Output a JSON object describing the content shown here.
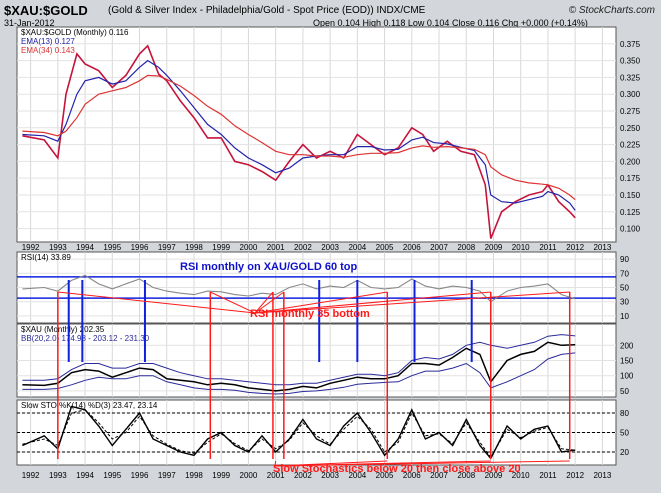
{
  "header": {
    "title": "$XAU:$GOLD",
    "subtitle": "(Gold & Silver Index - Philadelphia/Gold - Spot Price (EOD))  INDX/CME",
    "date": "31-Jan-2012",
    "ohlc": "Open 0.104  High 0.118  Low 0.104  Close 0.116  Chg +0.000 (+0.14%)",
    "brand": "© StockCharts.com"
  },
  "colors": {
    "price": "#c4143c",
    "ema13": "#2222aa",
    "ema34": "#dd3333",
    "annotation_red": "#ff1a1a",
    "annotation_blue": "#1020e0",
    "annotation_text": "#1010cc"
  },
  "chart_data": [
    {
      "type": "line",
      "panel": "price",
      "legend": [
        "$XAU:$GOLD (Monthly) 0.116",
        "EMA(13) 0.127",
        "EMA(34) 0.143"
      ],
      "yticks": [
        "0.375",
        "0.350",
        "0.325",
        "0.300",
        "0.275",
        "0.250",
        "0.225",
        "0.200",
        "0.175",
        "0.150",
        "0.125",
        "0.100"
      ],
      "ylim": [
        0.08,
        0.4
      ],
      "x": [
        1991.7,
        1992.5,
        1993.0,
        1993.3,
        1993.7,
        1994.0,
        1994.5,
        1995.0,
        1995.5,
        1996.0,
        1996.3,
        1996.7,
        1997.0,
        1997.5,
        1998.0,
        1998.5,
        1999.0,
        1999.5,
        2000.0,
        2000.5,
        2001.0,
        2001.5,
        2002.0,
        2002.5,
        2003.0,
        2003.5,
        2004.0,
        2004.5,
        2005.0,
        2005.5,
        2006.0,
        2006.4,
        2006.8,
        2007.3,
        2007.8,
        2008.3,
        2008.7,
        2008.9,
        2009.3,
        2009.8,
        2010.3,
        2010.8,
        2011.0,
        2011.4,
        2011.8,
        2012.0
      ],
      "series": [
        {
          "name": "$XAU:$GOLD (Monthly) 0.116",
          "values": [
            0.238,
            0.232,
            0.205,
            0.3,
            0.36,
            0.345,
            0.335,
            0.31,
            0.328,
            0.36,
            0.372,
            0.33,
            0.32,
            0.29,
            0.265,
            0.235,
            0.235,
            0.2,
            0.195,
            0.185,
            0.172,
            0.2,
            0.225,
            0.205,
            0.215,
            0.205,
            0.24,
            0.225,
            0.21,
            0.22,
            0.25,
            0.24,
            0.215,
            0.23,
            0.215,
            0.21,
            0.165,
            0.085,
            0.125,
            0.14,
            0.15,
            0.155,
            0.165,
            0.14,
            0.125,
            0.116
          ]
        },
        {
          "name": "EMA(13) 0.127",
          "values": [
            0.24,
            0.238,
            0.23,
            0.255,
            0.3,
            0.32,
            0.325,
            0.315,
            0.32,
            0.34,
            0.35,
            0.34,
            0.328,
            0.305,
            0.28,
            0.255,
            0.24,
            0.22,
            0.205,
            0.195,
            0.183,
            0.19,
            0.205,
            0.208,
            0.21,
            0.21,
            0.222,
            0.222,
            0.217,
            0.218,
            0.232,
            0.236,
            0.228,
            0.226,
            0.221,
            0.216,
            0.195,
            0.15,
            0.14,
            0.138,
            0.143,
            0.148,
            0.155,
            0.15,
            0.138,
            0.127
          ]
        },
        {
          "name": "EMA(34) 0.143",
          "values": [
            0.245,
            0.243,
            0.238,
            0.245,
            0.265,
            0.285,
            0.3,
            0.305,
            0.31,
            0.32,
            0.328,
            0.327,
            0.322,
            0.312,
            0.298,
            0.282,
            0.27,
            0.253,
            0.24,
            0.228,
            0.215,
            0.21,
            0.21,
            0.208,
            0.208,
            0.206,
            0.21,
            0.212,
            0.212,
            0.213,
            0.22,
            0.223,
            0.221,
            0.222,
            0.22,
            0.218,
            0.21,
            0.192,
            0.18,
            0.172,
            0.168,
            0.166,
            0.165,
            0.16,
            0.15,
            0.143
          ]
        }
      ],
      "xticks": [
        "1992",
        "1993",
        "1994",
        "1995",
        "1996",
        "1997",
        "1998",
        "1999",
        "2000",
        "2001",
        "2002",
        "2003",
        "2004",
        "2005",
        "2006",
        "2007",
        "2008",
        "2009",
        "2010",
        "2011",
        "2012",
        "2013"
      ]
    },
    {
      "type": "line",
      "panel": "rsi",
      "legend": [
        "RSI(14) 33.89"
      ],
      "annotations": [
        "RSI monthly on XAU/GOLD 60 top",
        "RSI monthly 35 bottom"
      ],
      "yticks": [
        "90",
        "70",
        "50",
        "30",
        "10"
      ],
      "ylim": [
        0,
        100
      ],
      "hlines": [
        65,
        35
      ],
      "x": [
        1991.7,
        1992.5,
        1993.0,
        1993.5,
        1994.0,
        1994.5,
        1995.0,
        1995.5,
        1996.0,
        1996.5,
        1997.0,
        1997.5,
        1998.0,
        1998.5,
        1999.0,
        1999.5,
        2000.0,
        2000.5,
        2001.0,
        2001.5,
        2002.0,
        2002.5,
        2003.0,
        2003.5,
        2004.0,
        2004.5,
        2005.0,
        2005.5,
        2006.0,
        2006.5,
        2007.0,
        2007.5,
        2008.0,
        2008.5,
        2008.9,
        2009.5,
        2010.0,
        2010.5,
        2011.0,
        2011.5,
        2012.0
      ],
      "series": [
        {
          "name": "RSI(14) 33.89",
          "values": [
            48,
            50,
            45,
            60,
            67,
            55,
            48,
            55,
            62,
            50,
            45,
            42,
            40,
            45,
            44,
            40,
            38,
            42,
            40,
            50,
            55,
            48,
            52,
            50,
            60,
            50,
            48,
            50,
            62,
            52,
            48,
            52,
            50,
            45,
            30,
            45,
            50,
            52,
            55,
            40,
            34
          ]
        }
      ]
    },
    {
      "type": "line",
      "panel": "xau",
      "legend": [
        "$XAU (Monthly) 202.35",
        "BB(20,2.0) 174.98 - 203.12 - 231.30"
      ],
      "yticks": [
        "200",
        "150",
        "100",
        "50"
      ],
      "ylim": [
        30,
        270
      ],
      "x": [
        1991.7,
        1992.5,
        1993.0,
        1993.5,
        1994.0,
        1994.5,
        1995.0,
        1995.5,
        1996.0,
        1996.5,
        1997.0,
        1997.5,
        1998.0,
        1998.5,
        1999.0,
        1999.5,
        2000.0,
        2000.5,
        2001.0,
        2001.5,
        2002.0,
        2002.5,
        2003.0,
        2003.5,
        2004.0,
        2004.5,
        2005.0,
        2005.5,
        2006.0,
        2006.5,
        2007.0,
        2007.5,
        2008.0,
        2008.5,
        2008.9,
        2009.5,
        2010.0,
        2010.5,
        2011.0,
        2011.5,
        2012.0
      ],
      "series": [
        {
          "name": "$XAU (Monthly) 202.35",
          "values": [
            70,
            68,
            75,
            110,
            120,
            115,
            95,
            110,
            125,
            120,
            90,
            85,
            80,
            70,
            75,
            70,
            60,
            55,
            50,
            55,
            65,
            60,
            75,
            85,
            95,
            90,
            90,
            100,
            140,
            140,
            135,
            160,
            190,
            170,
            80,
            150,
            170,
            180,
            210,
            200,
            202
          ]
        },
        {
          "name": "BB upper",
          "values": [
            85,
            85,
            90,
            120,
            140,
            140,
            125,
            125,
            140,
            140,
            125,
            110,
            100,
            90,
            90,
            85,
            80,
            75,
            70,
            70,
            75,
            75,
            85,
            95,
            105,
            105,
            100,
            110,
            150,
            160,
            155,
            170,
            200,
            210,
            200,
            190,
            200,
            210,
            230,
            235,
            231
          ]
        },
        {
          "name": "BB lower",
          "values": [
            55,
            55,
            58,
            70,
            85,
            95,
            90,
            90,
            100,
            100,
            80,
            70,
            60,
            55,
            55,
            52,
            45,
            42,
            40,
            42,
            48,
            50,
            55,
            62,
            72,
            75,
            78,
            80,
            100,
            115,
            115,
            125,
            140,
            110,
            60,
            80,
            100,
            120,
            155,
            170,
            175
          ]
        }
      ]
    },
    {
      "type": "line",
      "panel": "stochastic",
      "legend": [
        "Slow STO %K(14) %D(3) 23.47, 23.14"
      ],
      "annotations": [
        "Slow Stochastics below 20 then close above 20"
      ],
      "yticks": [
        "80",
        "50",
        "20"
      ],
      "ylim": [
        0,
        100
      ],
      "hlines": [
        80,
        50,
        20
      ],
      "x": [
        1991.7,
        1992.5,
        1993.0,
        1993.5,
        1994.0,
        1994.5,
        1995.0,
        1995.5,
        1996.0,
        1996.5,
        1997.0,
        1997.5,
        1998.0,
        1998.5,
        1999.0,
        1999.5,
        2000.0,
        2000.5,
        2001.0,
        2001.5,
        2002.0,
        2002.5,
        2003.0,
        2003.5,
        2004.0,
        2004.5,
        2005.0,
        2005.5,
        2006.0,
        2006.5,
        2007.0,
        2007.5,
        2008.0,
        2008.5,
        2008.9,
        2009.5,
        2010.0,
        2010.5,
        2011.0,
        2011.5,
        2012.0
      ],
      "series": [
        {
          "name": "%K",
          "values": [
            30,
            45,
            25,
            90,
            85,
            60,
            30,
            55,
            80,
            40,
            30,
            20,
            15,
            40,
            50,
            30,
            20,
            45,
            20,
            40,
            70,
            40,
            30,
            60,
            80,
            50,
            15,
            40,
            85,
            40,
            50,
            30,
            70,
            30,
            10,
            60,
            40,
            55,
            60,
            20,
            23
          ]
        },
        {
          "name": "%D",
          "values": [
            32,
            40,
            30,
            80,
            85,
            65,
            40,
            50,
            75,
            45,
            32,
            22,
            18,
            35,
            48,
            33,
            22,
            40,
            25,
            38,
            65,
            45,
            32,
            55,
            75,
            55,
            20,
            35,
            80,
            45,
            48,
            33,
            65,
            35,
            12,
            55,
            42,
            52,
            58,
            25,
            23
          ]
        }
      ]
    }
  ]
}
